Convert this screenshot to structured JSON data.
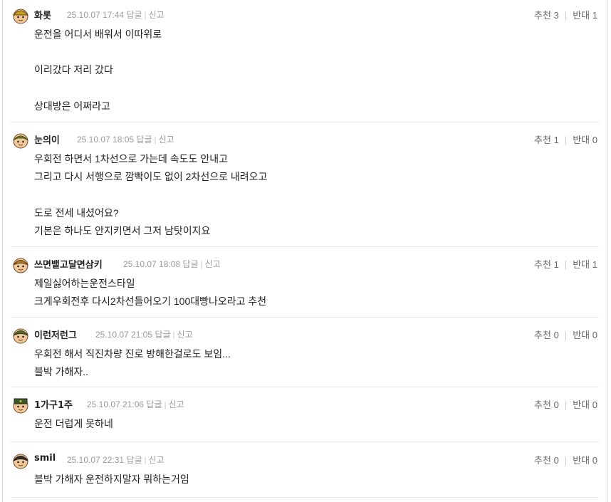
{
  "labels": {
    "reply": "답글",
    "report": "신고",
    "up": "추천",
    "down": "반대"
  },
  "comments": [
    {
      "nick": "화롯",
      "date": "25.10.07 17:44",
      "up": "3",
      "down": "1",
      "body": "운전을 어디서 배워서 이따위로\n\n이리갔다 저리 갔다\n\n상대방은 어쩌라고"
    },
    {
      "nick": "눈의이",
      "date": "25.10.07 18:05",
      "up": "1",
      "down": "0",
      "body": "우회전 하면서 1차선으로 가는데 속도도 안내고\n그리고 다시 서행으로 깜빡이도 없이 2차선으로 내려오고\n\n도로 전세 내셨어요?\n기본은 하나도 안지키면서 그저 남탓이지요"
    },
    {
      "nick": "쓰면뱉고달면삼키",
      "date": "25.10.07 18:08",
      "up": "1",
      "down": "1",
      "body": "제일싫어하는운전스타일\n크게우회전후 다시2차선들어오기 100대빵나오라고 추천"
    },
    {
      "nick": "이런저런그",
      "date": "25.10.07 21:05",
      "up": "0",
      "down": "0",
      "body": "우회전 해서 직진차량 진로 방해한걸로도 보임...\n블박 가해자.."
    },
    {
      "nick": "1가구1주",
      "date": "25.10.07 21:06",
      "up": "0",
      "down": "0",
      "body": "운전 더럽게 못하네"
    },
    {
      "nick": "smil",
      "date": "25.10.07 22:31",
      "up": "0",
      "down": "0",
      "body": "블박 가해자 운전하지말자 뭐하는거임"
    }
  ]
}
